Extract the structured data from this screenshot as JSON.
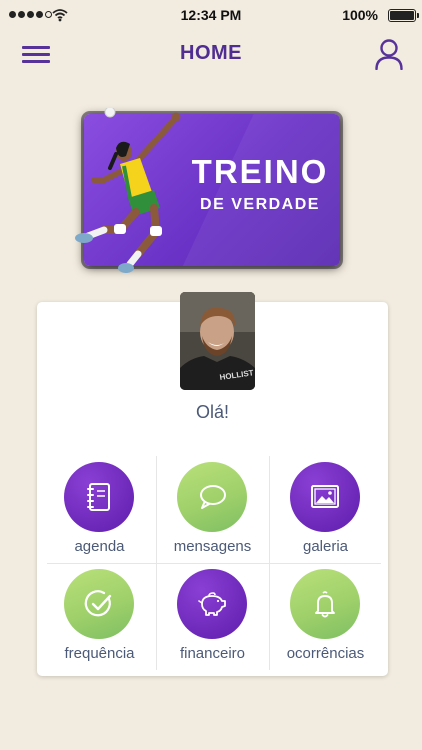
{
  "status_bar": {
    "time": "12:34 PM",
    "battery": "100%",
    "signal_bars": 4,
    "signal_max": 5,
    "battery_level": 1.0
  },
  "header": {
    "title": "HOME",
    "menu_icon": "hamburger-menu-icon",
    "user_icon": "user-profile-icon"
  },
  "banner": {
    "title": "TREINO",
    "subtitle": "DE VERDADE"
  },
  "profile": {
    "greeting": "Olá!"
  },
  "menu": [
    {
      "label": "agenda",
      "icon": "notebook-icon",
      "color": "#6b27b8"
    },
    {
      "label": "mensagens",
      "icon": "chat-bubble-icon",
      "color": "#9fd06a"
    },
    {
      "label": "galeria",
      "icon": "image-gallery-icon",
      "color": "#6b27b8"
    },
    {
      "label": "frequência",
      "icon": "check-circle-icon",
      "color": "#9fd06a"
    },
    {
      "label": "financeiro",
      "icon": "piggy-bank-icon",
      "color": "#6b27b8"
    },
    {
      "label": "ocorrências",
      "icon": "bell-icon",
      "color": "#9fd06a"
    }
  ],
  "colors": {
    "background": "#f2ebdf",
    "primary": "#4f2d91",
    "accent_green": "#9fd06a",
    "text": "#4c5a78"
  }
}
